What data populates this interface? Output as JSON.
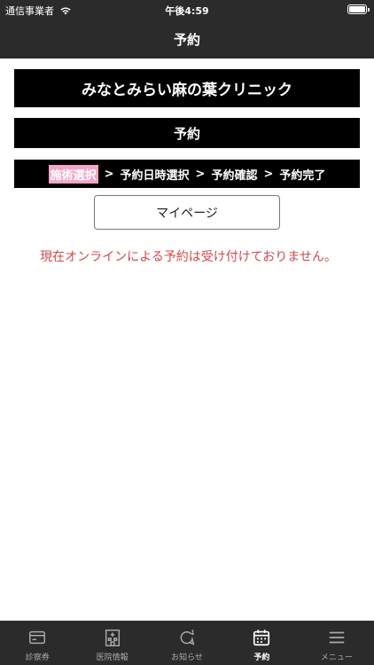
{
  "status_bar": {
    "carrier": "通信事業者",
    "time": "午後4:59"
  },
  "nav": {
    "title": "予約"
  },
  "clinic_name": "みなとみらい麻の葉クリニック",
  "section_title": "予約",
  "steps": [
    {
      "label": "施術選択",
      "active": true
    },
    {
      "label": "予約日時選択",
      "active": false
    },
    {
      "label": "予約確認",
      "active": false
    },
    {
      "label": "予約完了",
      "active": false
    }
  ],
  "step_separator": ">",
  "mypage_button": "マイページ",
  "notice": "現在オンラインによる予約は受け付けておりません。",
  "tabs": [
    {
      "label": "診察券",
      "icon": "card-icon",
      "active": false
    },
    {
      "label": "医院情報",
      "icon": "hospital-icon",
      "active": false
    },
    {
      "label": "お知らせ",
      "icon": "notification-icon",
      "active": false
    },
    {
      "label": "予約",
      "icon": "calendar-icon",
      "active": true
    },
    {
      "label": "メニュー",
      "icon": "menu-icon",
      "active": false
    }
  ],
  "colors": {
    "header_bg": "#2b2b2b",
    "banner_bg": "#000000",
    "notice_text": "#d2474b",
    "active_step_highlight": "#f2a6c7"
  }
}
